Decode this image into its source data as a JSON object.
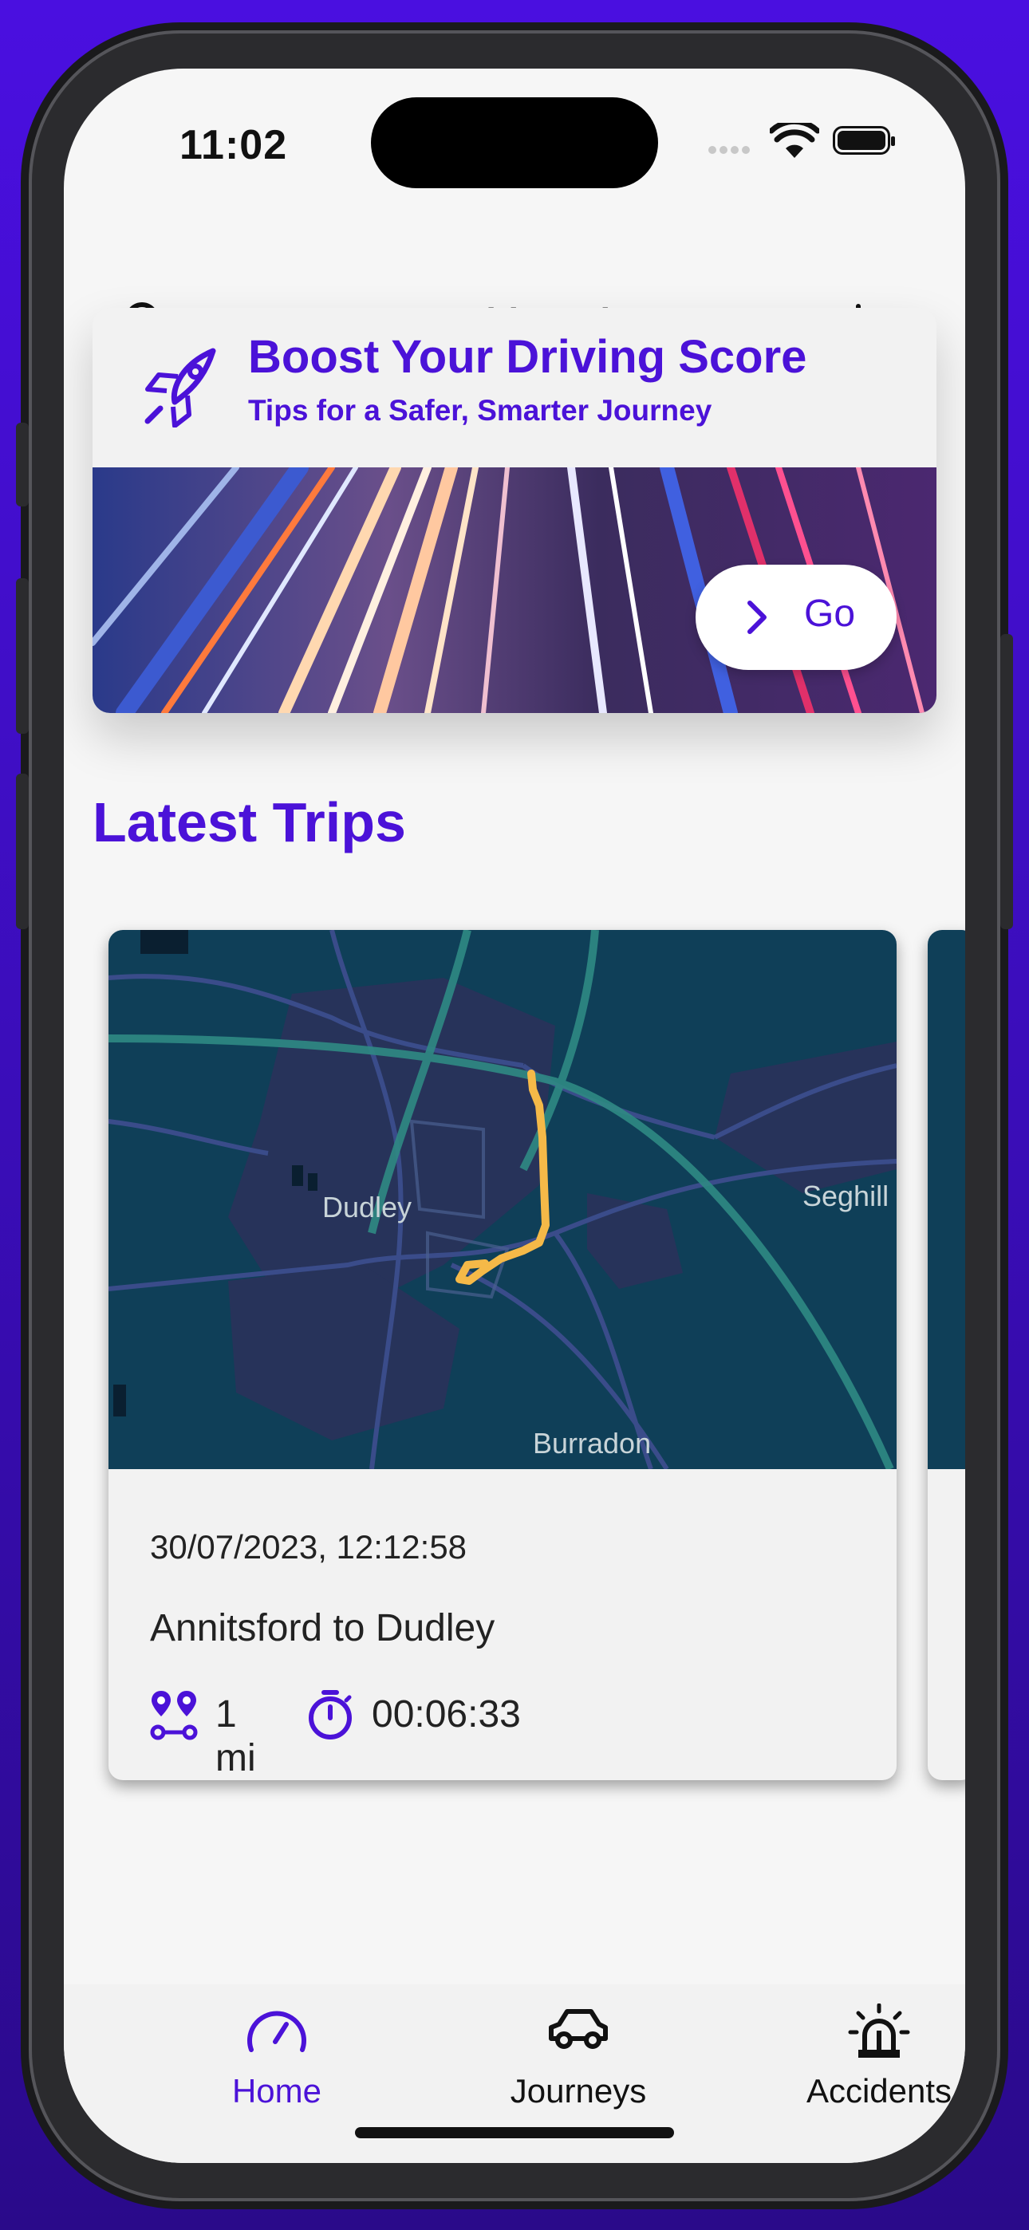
{
  "status_bar": {
    "time": "11:02"
  },
  "header": {
    "title": "Dashboard",
    "profile_icon": "user-icon",
    "stats_icon": "bar-chart-icon"
  },
  "promo": {
    "title": "Boost Your Driving Score",
    "subtitle": "Tips for a Safer, Smarter Journey",
    "icon": "rocket-icon",
    "button_label": "Go",
    "accent_color": "#4b12d8"
  },
  "latest_trips": {
    "heading": "Latest Trips",
    "trips": [
      {
        "map_labels": [
          "Dudley",
          "Seghill",
          "Burradon"
        ],
        "date": "30/07/2023, 12:12:58",
        "route": "Annitsford to Dudley",
        "distance": "1 mi",
        "duration": "00:06:33"
      }
    ]
  },
  "tab_bar": {
    "items": [
      {
        "label": "Home",
        "icon": "speedometer-icon",
        "active": true
      },
      {
        "label": "Journeys",
        "icon": "car-icon",
        "active": false
      },
      {
        "label": "Accidents",
        "icon": "siren-icon",
        "active": false
      }
    ],
    "active_color": "#4b12d8"
  }
}
